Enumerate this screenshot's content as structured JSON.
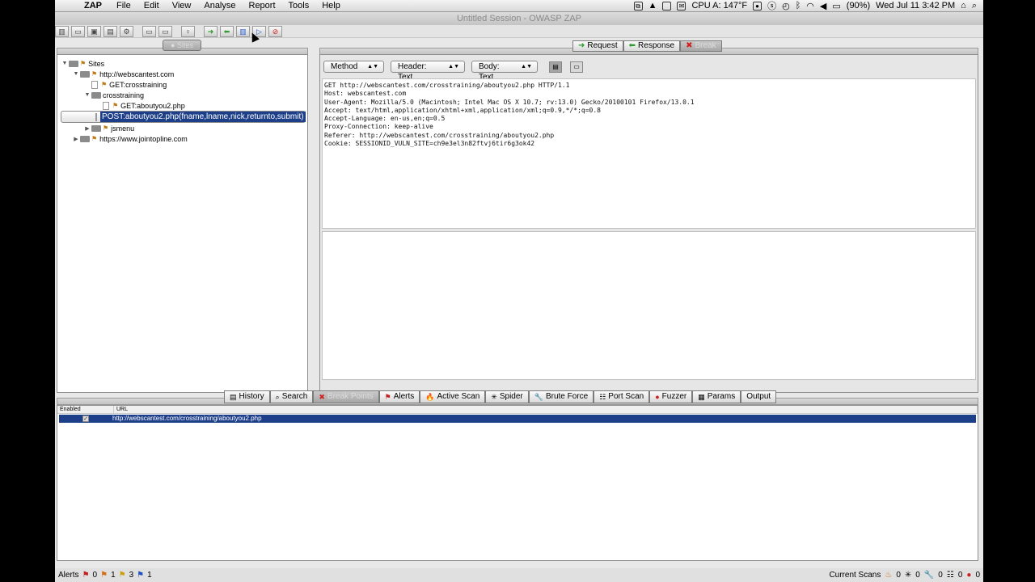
{
  "menubar": {
    "app": "ZAP",
    "menus": [
      "File",
      "Edit",
      "View",
      "Analyse",
      "Report",
      "Tools",
      "Help"
    ],
    "cpu": "CPU A: 147°F",
    "battery": "(90%)",
    "clock": "Wed Jul 11  3:42 PM"
  },
  "window": {
    "title": "Untitled Session - OWASP ZAP"
  },
  "sites": {
    "tab_label": "Sites",
    "tree": [
      {
        "label": "Sites",
        "depth": 0,
        "toggle": "▼",
        "kind": "root"
      },
      {
        "label": "http://webscantest.com",
        "depth": 1,
        "toggle": "▼",
        "kind": "folder-flag"
      },
      {
        "label": "GET:crosstraining",
        "depth": 2,
        "toggle": "",
        "kind": "page-flag"
      },
      {
        "label": "crosstraining",
        "depth": 2,
        "toggle": "▼",
        "kind": "folder"
      },
      {
        "label": "GET:aboutyou2.php",
        "depth": 3,
        "toggle": "",
        "kind": "page-flag"
      },
      {
        "label": "POST:aboutyou2.php(fname,lname,nick,returnto,submit)",
        "depth": 3,
        "toggle": "",
        "kind": "page",
        "selected": true
      },
      {
        "label": "jsmenu",
        "depth": 2,
        "toggle": "▶",
        "kind": "folder-flag"
      },
      {
        "label": "https://www.jointopline.com",
        "depth": 1,
        "toggle": "▶",
        "kind": "folder-flag"
      }
    ]
  },
  "request_tabs": {
    "request": "Request",
    "response": "Response",
    "break": "Break"
  },
  "request_view": {
    "method_select": "Method",
    "header_select": "Header: Text",
    "body_select": "Body: Text",
    "header_lines": [
      "GET http://webscantest.com/crosstraining/aboutyou2.php HTTP/1.1",
      "Host: webscantest.com",
      "User-Agent: Mozilla/5.0 (Macintosh; Intel Mac OS X 10.7; rv:13.0) Gecko/20100101 Firefox/13.0.1",
      "Accept: text/html,application/xhtml+xml,application/xml;q=0.9,*/*;q=0.8",
      "Accept-Language: en-us,en;q=0.5",
      "Proxy-Connection: keep-alive",
      "Referer: http://webscantest.com/crosstraining/aboutyou2.php",
      "Cookie: SESSIONID_VULN_SITE=ch9e3el3n82ftvj6tir6g3ok42"
    ]
  },
  "bottom_tabs": [
    {
      "label": "History",
      "icon": "▤",
      "dim": false
    },
    {
      "label": "Search",
      "icon": "⌕",
      "dim": false
    },
    {
      "label": "Break Points",
      "icon": "✖",
      "dim": true
    },
    {
      "label": "Alerts",
      "icon": "⚑",
      "dim": false
    },
    {
      "label": "Active Scan",
      "icon": "🔥",
      "dim": false
    },
    {
      "label": "Spider",
      "icon": "✳",
      "dim": false
    },
    {
      "label": "Brute Force",
      "icon": "🔧",
      "dim": false
    },
    {
      "label": "Port Scan",
      "icon": "☷",
      "dim": false
    },
    {
      "label": "Fuzzer",
      "icon": "●",
      "dim": false
    },
    {
      "label": "Params",
      "icon": "▦",
      "dim": false
    },
    {
      "label": "Output",
      "icon": "",
      "dim": false
    }
  ],
  "breakpoints_table": {
    "columns": [
      "Enabled",
      "URL"
    ],
    "rows": [
      {
        "enabled": true,
        "url": "http://webscantest.com/crosstraining/aboutyou2.php"
      }
    ]
  },
  "statusbar": {
    "alerts_label": "Alerts",
    "alert_counts": [
      "0",
      "1",
      "3",
      "1"
    ],
    "current_scans_label": "Current Scans",
    "scan_counts": [
      "0",
      "0",
      "0",
      "0",
      "0"
    ]
  }
}
